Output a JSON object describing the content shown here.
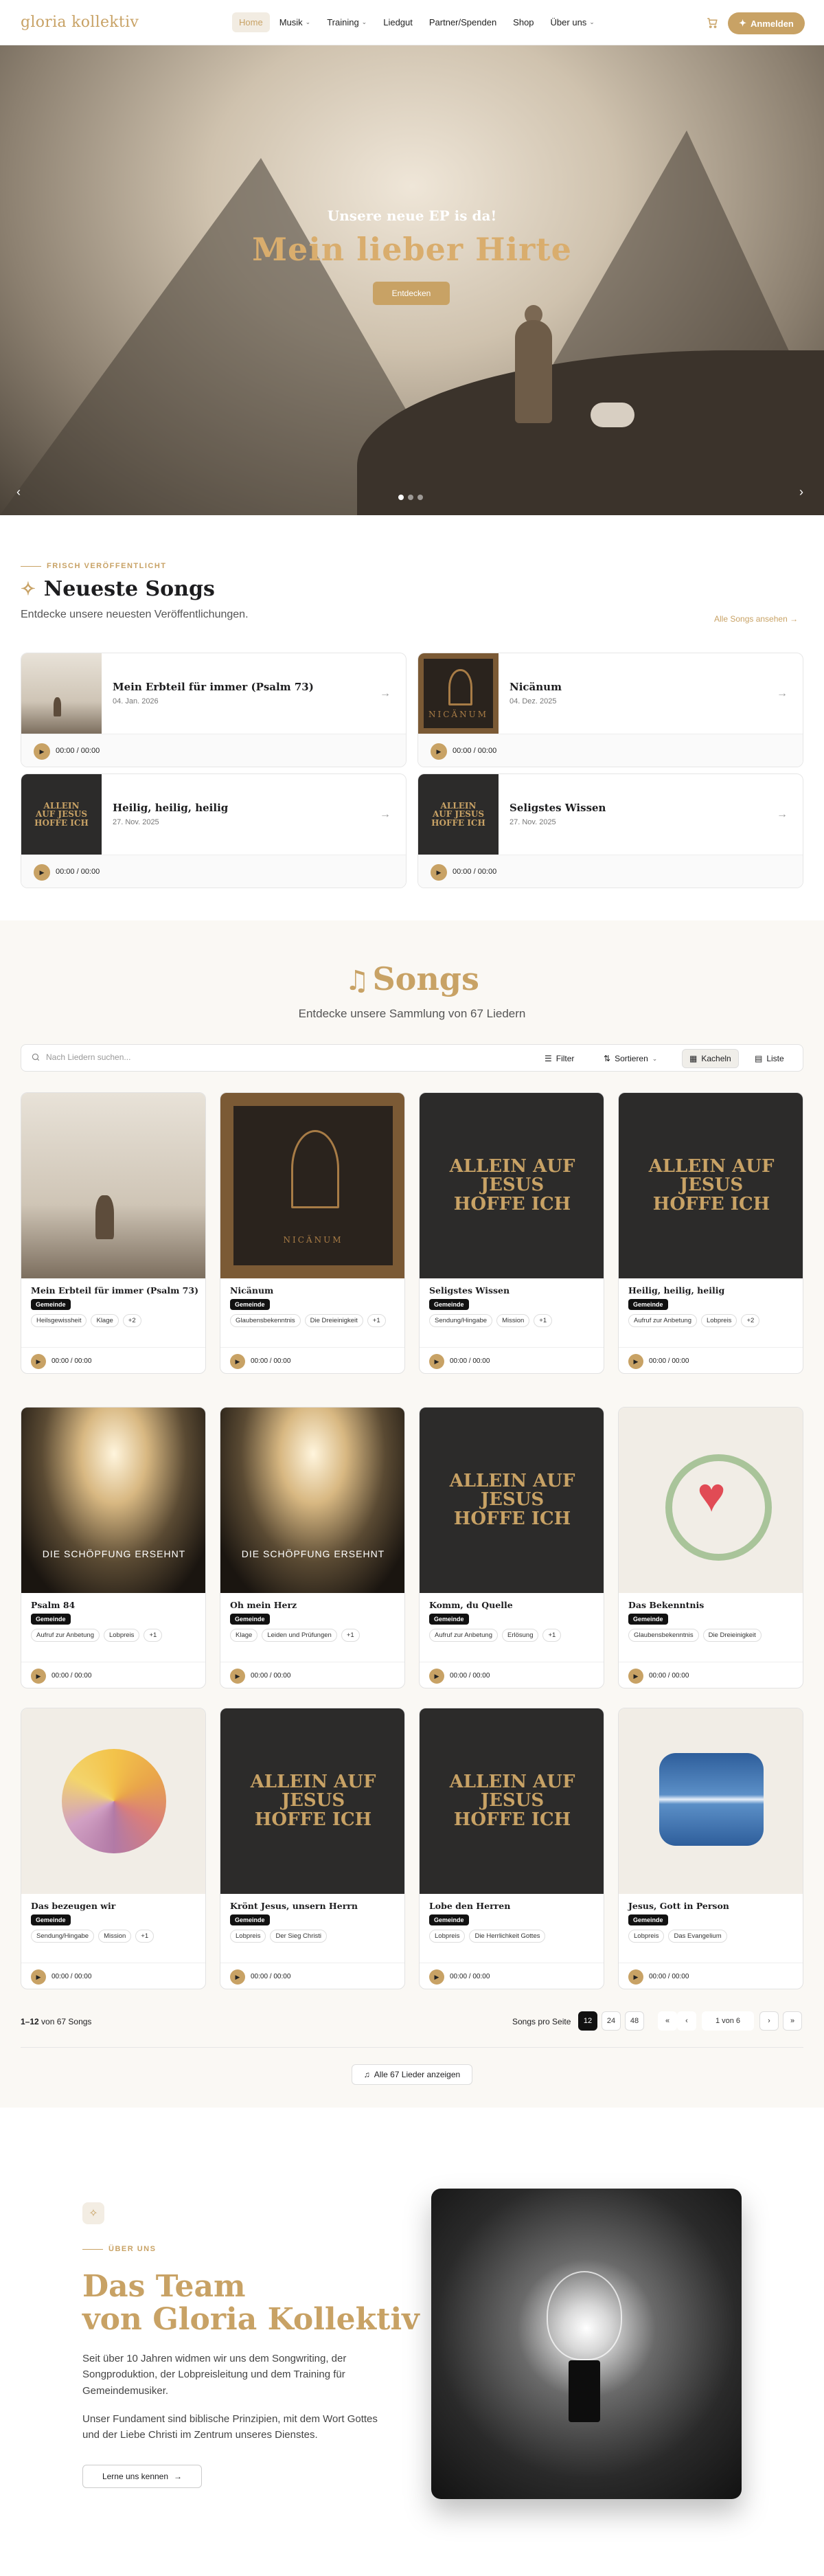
{
  "header": {
    "logo": "gloria kollektiv",
    "nav": [
      {
        "label": "Home",
        "dropdown": false,
        "active": true
      },
      {
        "label": "Musik",
        "dropdown": true
      },
      {
        "label": "Training",
        "dropdown": true
      },
      {
        "label": "Liedgut",
        "dropdown": false
      },
      {
        "label": "Partner/Spenden",
        "dropdown": false
      },
      {
        "label": "Shop",
        "dropdown": false
      },
      {
        "label": "Über uns",
        "dropdown": true
      }
    ],
    "login_label": "Anmelden",
    "cart_icon": "cart-icon"
  },
  "hero": {
    "subtitle": "Unsere neue EP is da!",
    "title": "Mein lieber Hirte",
    "button": "Entdecken",
    "slides": 3,
    "active_slide": 1
  },
  "latest": {
    "eyebrow": "FRISCH VERÖFFENTLICHT",
    "title": "Neueste Songs",
    "subtitle": "Entdecke unsere neuesten Veröffentlichungen.",
    "all_link": "Alle Songs ansehen",
    "items": [
      {
        "title": "Mein Erbteil für immer (Psalm 73)",
        "date": "04. Jan. 2026",
        "art": "sheep",
        "time": "00:00 / 00:00"
      },
      {
        "title": "Nicänum",
        "date": "04. Dez. 2025",
        "art": "nicaenum",
        "time": "00:00 / 00:00"
      },
      {
        "title": "Heilig, heilig, heilig",
        "date": "27. Nov. 2025",
        "art": "allein",
        "time": "00:00 / 00:00"
      },
      {
        "title": "Seligstes Wissen",
        "date": "27. Nov. 2025",
        "art": "allein",
        "time": "00:00 / 00:00"
      }
    ]
  },
  "songs": {
    "title": "Songs",
    "subtitle": "Entdecke unsere Sammlung von 67 Liedern",
    "search_placeholder": "Nach Liedern suchen...",
    "filter_label": "Filter",
    "sort_label": "Sortieren",
    "view_tiles": "Kacheln",
    "view_list": "Liste",
    "cards": [
      {
        "title": "Mein Erbteil für immer (Psalm 73)",
        "badge": "Gemeinde",
        "tags": [
          "Heilsgewissheit",
          "Klage",
          "+2"
        ],
        "art": "sheep"
      },
      {
        "title": "Nicänum",
        "badge": "Gemeinde",
        "tags": [
          "Glaubensbekenntnis",
          "Die Dreieinigkeit",
          "+1"
        ],
        "art": "nicaenum"
      },
      {
        "title": "Seligstes Wissen",
        "badge": "Gemeinde",
        "tags": [
          "Sendung/Hingabe",
          "Mission",
          "+1"
        ],
        "art": "allein"
      },
      {
        "title": "Heilig, heilig, heilig",
        "badge": "Gemeinde",
        "tags": [
          "Aufruf zur Anbetung",
          "Lobpreis",
          "+2"
        ],
        "art": "allein"
      },
      {
        "title": "Psalm 84",
        "badge": "Gemeinde",
        "tags": [
          "Aufruf zur Anbetung",
          "Lobpreis",
          "+1"
        ],
        "art": "concert"
      },
      {
        "title": "Oh mein Herz",
        "badge": "Gemeinde",
        "tags": [
          "Klage",
          "Leiden und Prüfungen",
          "+1"
        ],
        "art": "concert"
      },
      {
        "title": "Komm, du Quelle",
        "badge": "Gemeinde",
        "tags": [
          "Aufruf zur Anbetung",
          "Erlösung",
          "+1"
        ],
        "art": "allein"
      },
      {
        "title": "Das Bekenntnis",
        "badge": "Gemeinde",
        "tags": [
          "Glaubensbekenntnis",
          "Die Dreieinigkeit"
        ],
        "art": "heart"
      },
      {
        "title": "Das bezeugen wir",
        "badge": "Gemeinde",
        "tags": [
          "Sendung/Hingabe",
          "Mission",
          "+1"
        ],
        "art": "sun"
      },
      {
        "title": "Krönt Jesus, unsern Herrn",
        "badge": "Gemeinde",
        "tags": [
          "Lobpreis",
          "Der Sieg Christi"
        ],
        "art": "allein"
      },
      {
        "title": "Lobe den Herren",
        "badge": "Gemeinde",
        "tags": [
          "Lobpreis",
          "Die Herrlichkeit Gottes"
        ],
        "art": "allein"
      },
      {
        "title": "Jesus, Gott in Person",
        "badge": "Gemeinde",
        "tags": [
          "Lobpreis",
          "Das Evangelium"
        ],
        "art": "wave"
      }
    ],
    "time": "00:00 / 00:00",
    "art_text_allein": "ALLEIN AUF JESUS HOFFE ICH",
    "art_text_nicaenum": "NICÄNUM",
    "art_text_concert": "DIE SCHÖPFUNG ERSEHNT",
    "pagination": {
      "range": "1–12",
      "range_suffix": "von 67 Songs",
      "per_page_label": "Songs pro Seite",
      "per_page_options": [
        "12",
        "24",
        "48"
      ],
      "selected_per_page": "12",
      "page_info": "1 von 6"
    },
    "show_all": "Alle 67 Lieder anzeigen"
  },
  "team": {
    "eyebrow": "ÜBER UNS",
    "title_line1": "Das Team",
    "title_line2": "von Gloria Kollektiv",
    "p1": "Seit über 10 Jahren widmen wir uns dem Songwriting, der Songproduktion, der Lobpreisleitung und dem Training für Gemeindemusiker.",
    "p2": "Unser Fundament sind biblische Prinzipien, mit dem Wort Gottes und der Liebe Christi im Zentrum unseres Dienstes.",
    "button": "Lerne uns kennen"
  },
  "colors": {
    "accent": "#c8a265",
    "dark": "#111111"
  }
}
